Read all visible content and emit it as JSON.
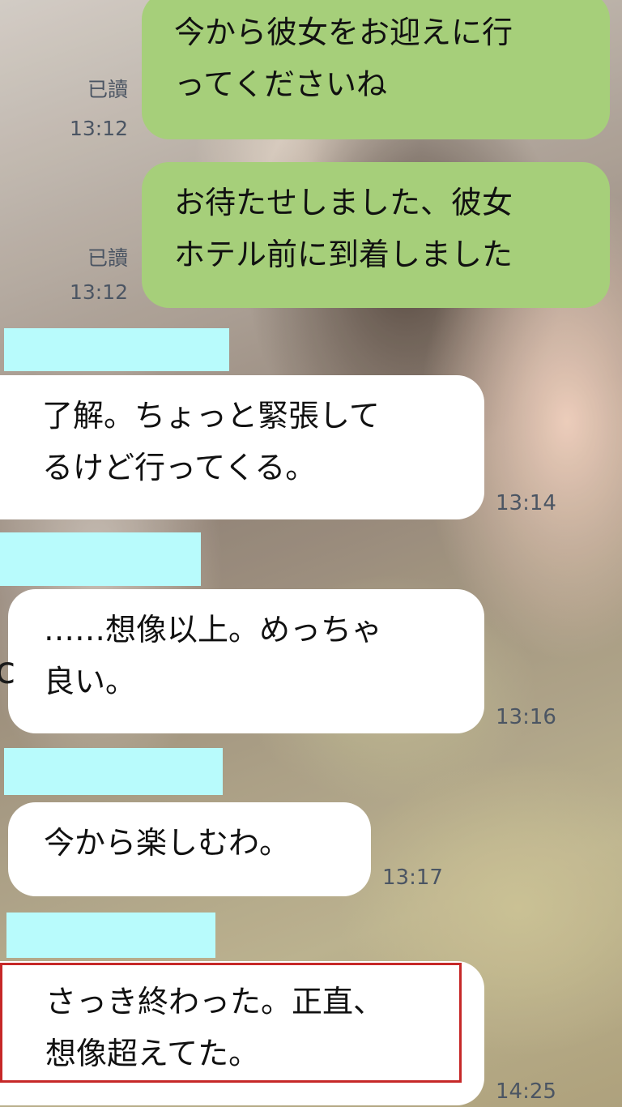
{
  "messages": [
    {
      "type": "sent",
      "text": "今から彼女をお迎えに行\nってくださいね",
      "read": "已讀",
      "time": "13:12"
    },
    {
      "type": "sent",
      "text": "お待たせしました、彼女\nホテル前に到着しました",
      "read": "已讀",
      "time": "13:12"
    },
    {
      "type": "received",
      "text": "了解。ちょっと緊張して\nるけど行ってくる。",
      "time": "13:14"
    },
    {
      "type": "received",
      "text": "……想像以上。めっちゃ\n良い。",
      "time": "13:16"
    },
    {
      "type": "received",
      "text": "今から楽しむわ。",
      "time": "13:17"
    },
    {
      "type": "received",
      "text": "さっき終わった。正直、\n想像超えてた。",
      "time": "14:25"
    }
  ],
  "colors": {
    "sent_bubble": "#a6cf7a",
    "received_bubble": "#ffffff",
    "name_redaction": "#b8fbfc",
    "highlight_border": "#c62828"
  },
  "edge_glyph": "c"
}
